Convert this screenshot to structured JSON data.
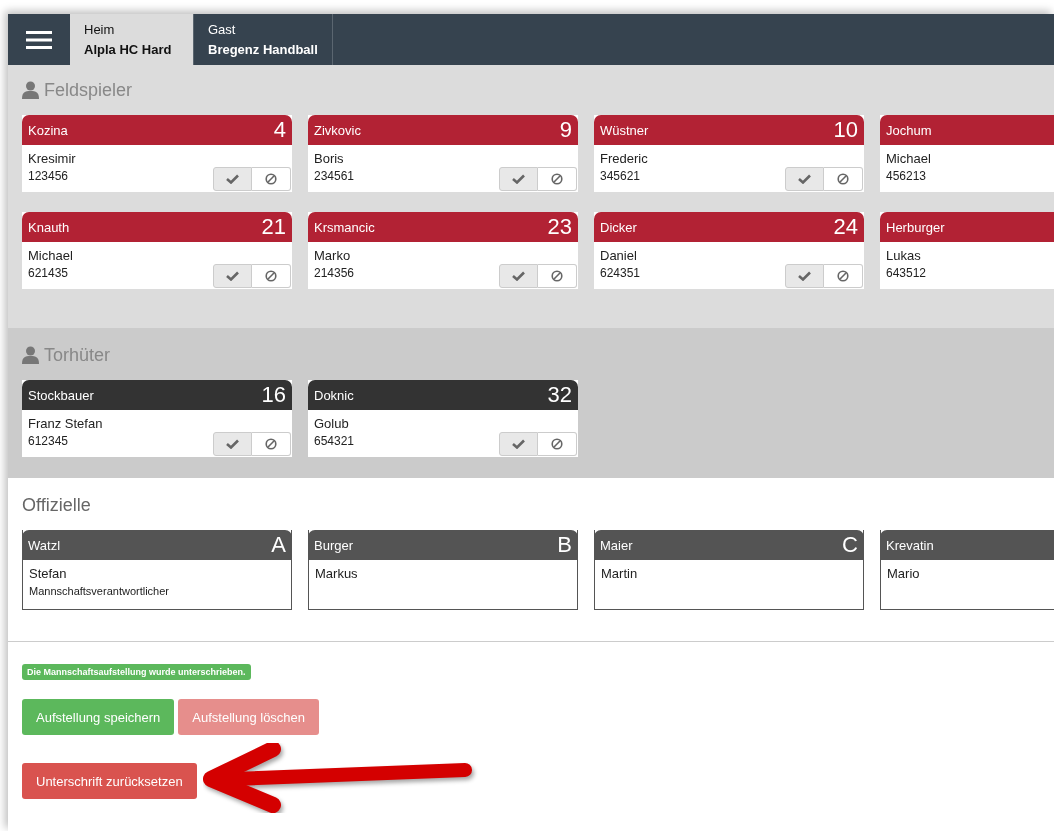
{
  "tabs": [
    {
      "label": "Heim",
      "team": "Alpla HC Hard",
      "selected": true
    },
    {
      "label": "Gast",
      "team": "Bregenz Handball",
      "selected": false
    }
  ],
  "sections": [
    {
      "title": "Feldspieler",
      "kind": "players",
      "cards": [
        {
          "surname": "Kozina",
          "number": "4",
          "first": "Kresimir",
          "id": "123456",
          "confirmed": true
        },
        {
          "surname": "Zivkovic",
          "number": "9",
          "first": "Boris",
          "id": "234561",
          "confirmed": true
        },
        {
          "surname": "Wüstner",
          "number": "10",
          "first": "Frederic",
          "id": "345621",
          "confirmed": true
        },
        {
          "surname": "Jochum",
          "first": "Michael",
          "id": "456213"
        },
        {
          "surname": "Knauth",
          "number": "21",
          "first": "Michael",
          "id": "621435",
          "confirmed": true
        },
        {
          "surname": "Krsmancic",
          "number": "23",
          "first": "Marko",
          "id": "214356",
          "confirmed": true
        },
        {
          "surname": "Dicker",
          "number": "24",
          "first": "Daniel",
          "id": "624351",
          "confirmed": true
        },
        {
          "surname": "Herburger",
          "first": "Lukas",
          "id": "643512"
        }
      ]
    },
    {
      "title": "Torhüter",
      "kind": "goalkeepers",
      "cards": [
        {
          "surname": "Stockbauer",
          "number": "16",
          "first": "Franz Stefan",
          "id": "612345",
          "confirmed": true
        },
        {
          "surname": "Doknic",
          "number": "32",
          "first": "Golub",
          "id": "654321",
          "confirmed": true
        }
      ]
    },
    {
      "title": "Offizielle",
      "kind": "officials",
      "cards": [
        {
          "surname": "Watzl",
          "number": "A",
          "first": "Stefan",
          "role": "Mannschaftsverantwortlicher"
        },
        {
          "surname": "Burger",
          "number": "B",
          "first": "Markus"
        },
        {
          "surname": "Maier",
          "number": "C",
          "first": "Martin"
        },
        {
          "surname": "Krevatin",
          "first": "Mario"
        }
      ]
    }
  ],
  "status_badge": "Die Mannschaftsaufstellung wurde unterschrieben.",
  "buttons": [
    {
      "label": "Aufstellung speichern",
      "kind": "save",
      "disabled": false
    },
    {
      "label": "Aufstellung löschen",
      "kind": "delete",
      "disabled": true
    }
  ],
  "reset_button": "Unterschrift zurücksetzen"
}
